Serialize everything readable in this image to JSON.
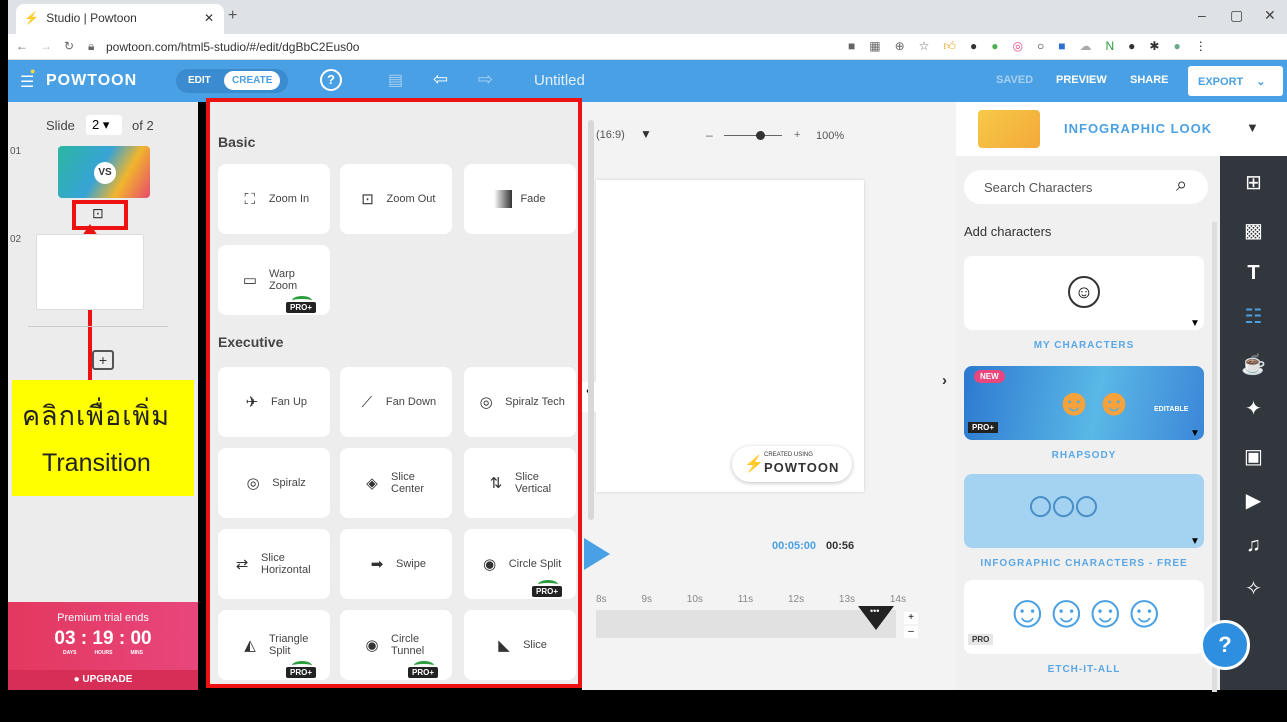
{
  "browser": {
    "tab_title": "Studio | Powtoon",
    "url": "powtoon.com/html5-studio/#/edit/dgBbC2Eus0o",
    "new_tab": "+",
    "win_min": "–",
    "win_max": "▢",
    "win_close": "✕"
  },
  "toolbar": {
    "logo": "POWTOON",
    "mode_edit": "EDIT",
    "mode_create": "CREATE",
    "help": "?",
    "title": "Untitled",
    "saved": "SAVED",
    "preview": "PREVIEW",
    "share": "SHARE",
    "export": "EXPORT"
  },
  "slides": {
    "label": "Slide",
    "current": "2",
    "of": "of 2",
    "num1": "01",
    "num2": "02",
    "thumb1_text": "VS",
    "add": "+"
  },
  "annotation": {
    "line1": "คลิกเพื่อเพิ่ม",
    "line2": "Transition",
    "color_box": "#ffff00",
    "color_outline": "#ee1111"
  },
  "premium": {
    "title": "Premium trial ends",
    "days": "03",
    "hours": "19",
    "mins": "00",
    "days_label": "DAYS",
    "hours_label": "HOURS",
    "mins_label": "MINS",
    "upgrade": "UPGRADE"
  },
  "transitions": {
    "basic_header": "Basic",
    "executive_header": "Executive",
    "pro_badge": "PRO+",
    "basic": [
      {
        "label": "Zoom In",
        "icon": "zoom-in-icon"
      },
      {
        "label": "Zoom Out",
        "icon": "zoom-out-icon"
      },
      {
        "label": "Fade",
        "icon": "fade-icon"
      },
      {
        "label": "Warp Zoom",
        "icon": "warp-zoom-icon",
        "pro": true
      }
    ],
    "executive": [
      {
        "label": "Fan Up",
        "icon": "fan-up-icon"
      },
      {
        "label": "Fan Down",
        "icon": "fan-down-icon"
      },
      {
        "label": "Spiralz Tech",
        "icon": "spiralz-tech-icon"
      },
      {
        "label": "Spiralz",
        "icon": "spiralz-icon"
      },
      {
        "label": "Slice Center",
        "icon": "slice-center-icon"
      },
      {
        "label": "Slice Vertical",
        "icon": "slice-vertical-icon"
      },
      {
        "label": "Slice Horizontal",
        "icon": "slice-horizontal-icon"
      },
      {
        "label": "Swipe",
        "icon": "swipe-icon"
      },
      {
        "label": "Circle Split",
        "icon": "circle-split-icon",
        "pro": true
      },
      {
        "label": "Triangle Split",
        "icon": "triangle-split-icon",
        "pro": true
      },
      {
        "label": "Circle Tunnel",
        "icon": "circle-tunnel-icon",
        "pro": true
      },
      {
        "label": "Slice",
        "icon": "slice-icon"
      }
    ]
  },
  "canvas": {
    "ratio": "(16:9)",
    "zoom_minus": "–",
    "zoom_plus": "+",
    "zoom": "100%",
    "watermark_small": "CREATED USING",
    "watermark_big": "POWTOON",
    "time_current": "00:05:00",
    "time_total": "00:56",
    "ticks": [
      "8s",
      "9s",
      "10s",
      "11s",
      "12s",
      "13s",
      "14s"
    ],
    "collapse": "‹",
    "expand": "›"
  },
  "library": {
    "style": "INFOGRAPHIC LOOK",
    "search_placeholder": "Search Characters",
    "add_characters": "Add characters",
    "cards": [
      {
        "label": "MY CHARACTERS"
      },
      {
        "label": "RHAPSODY",
        "new": "NEW",
        "editable": "EDITABLE",
        "pro": "PRO+"
      },
      {
        "label": "INFOGRAPHIC CHARACTERS - FREE"
      },
      {
        "label": "ETCH-IT-ALL",
        "pro": "PRO"
      }
    ],
    "help": "?"
  },
  "colors": {
    "accent": "#4aa0e4",
    "red": "#ee1111",
    "dark": "#31373d",
    "pink": "#e8467c"
  }
}
